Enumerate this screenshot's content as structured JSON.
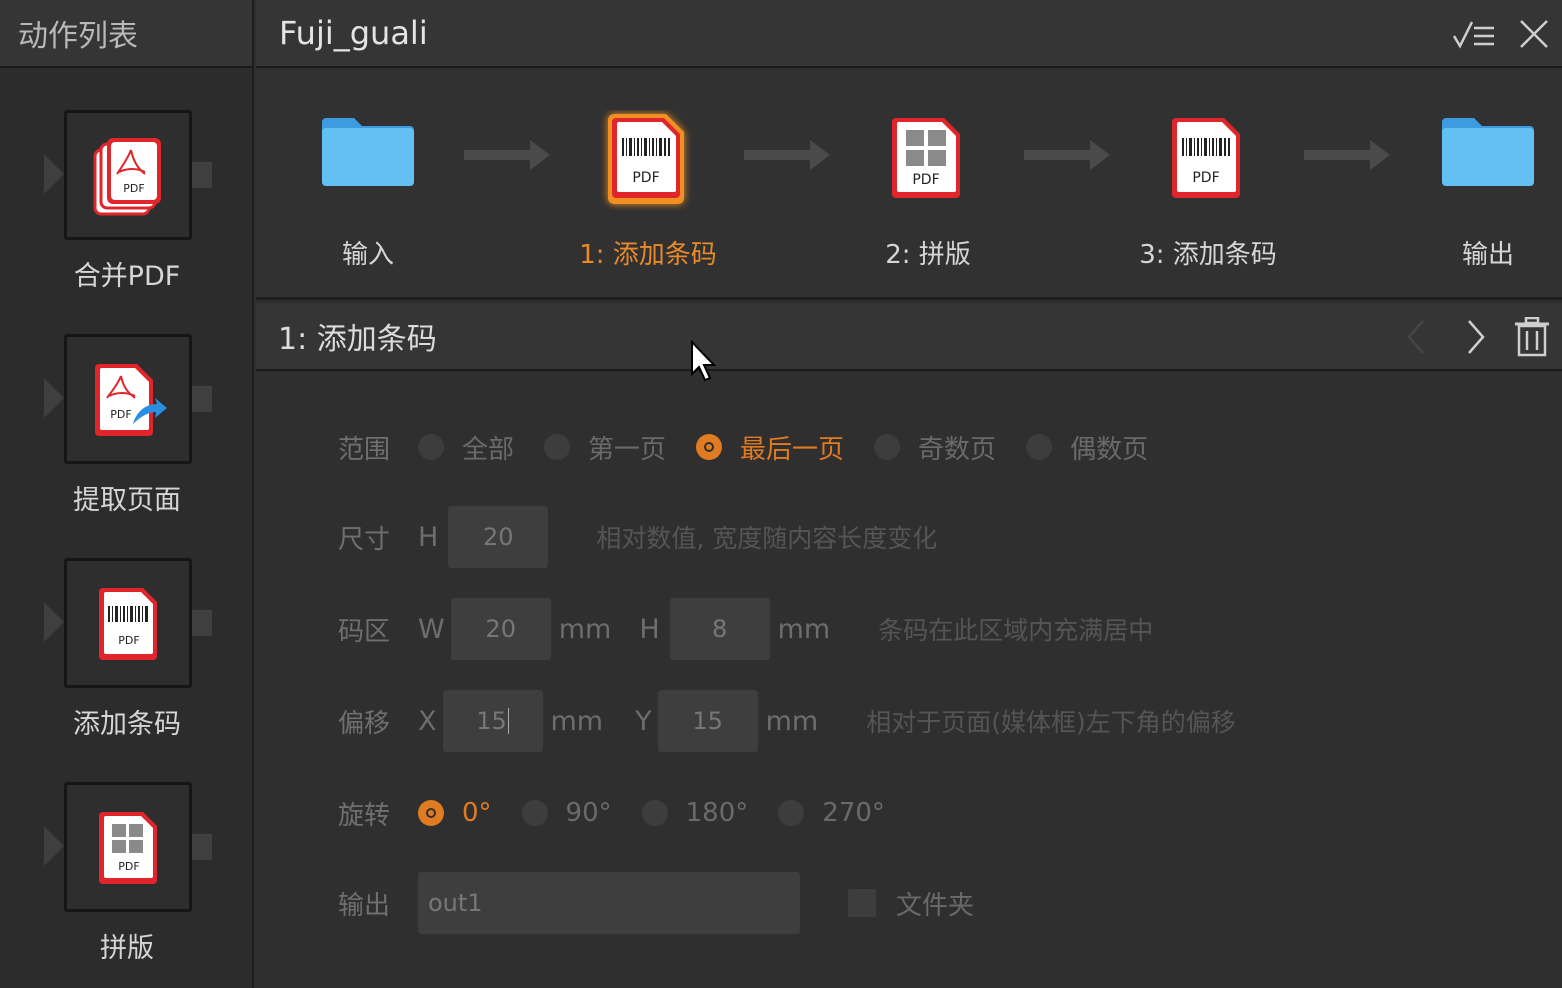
{
  "sidebar": {
    "title": "动作列表",
    "items": [
      {
        "label": "合并PDF",
        "icon": "merge-pdf-icon"
      },
      {
        "label": "提取页面",
        "icon": "extract-pages-icon"
      },
      {
        "label": "添加条码",
        "icon": "barcode-pdf-icon"
      },
      {
        "label": "拼版",
        "icon": "imposition-pdf-icon"
      }
    ]
  },
  "header": {
    "title": "Fuji_guali"
  },
  "flow": {
    "steps": [
      {
        "label": "输入",
        "icon": "folder-icon"
      },
      {
        "label": "1: 添加条码",
        "icon": "barcode-pdf-icon",
        "active": true
      },
      {
        "label": "2: 拼版",
        "icon": "imposition-pdf-icon"
      },
      {
        "label": "3: 添加条码",
        "icon": "barcode-pdf-icon"
      },
      {
        "label": "输出",
        "icon": "folder-icon"
      }
    ]
  },
  "detail": {
    "title": "1: 添加条码"
  },
  "form": {
    "range": {
      "label": "范围",
      "options": [
        "全部",
        "第一页",
        "最后一页",
        "奇数页",
        "偶数页"
      ],
      "selected": "最后一页"
    },
    "size": {
      "label": "尺寸",
      "h_label": "H",
      "h_value": "20",
      "hint": "相对数值, 宽度随内容长度变化"
    },
    "area": {
      "label": "码区",
      "w_label": "W",
      "w_value": "20",
      "w_unit": "mm",
      "h_label": "H",
      "h_value": "8",
      "h_unit": "mm",
      "hint": "条码在此区域内充满居中"
    },
    "offset": {
      "label": "偏移",
      "x_label": "X",
      "x_value": "15",
      "x_unit": "mm",
      "y_label": "Y",
      "y_value": "15",
      "y_unit": "mm",
      "hint": "相对于页面(媒体框)左下角的偏移"
    },
    "rotation": {
      "label": "旋转",
      "options": [
        "0°",
        "90°",
        "180°",
        "270°"
      ],
      "selected": "0°"
    },
    "output": {
      "label": "输出",
      "value": "out1",
      "folder_label": "文件夹",
      "folder_checked": false
    }
  },
  "colors": {
    "accent": "#e07b22",
    "pdf_red": "#e0262b",
    "folder_blue": "#5ab8ee"
  }
}
